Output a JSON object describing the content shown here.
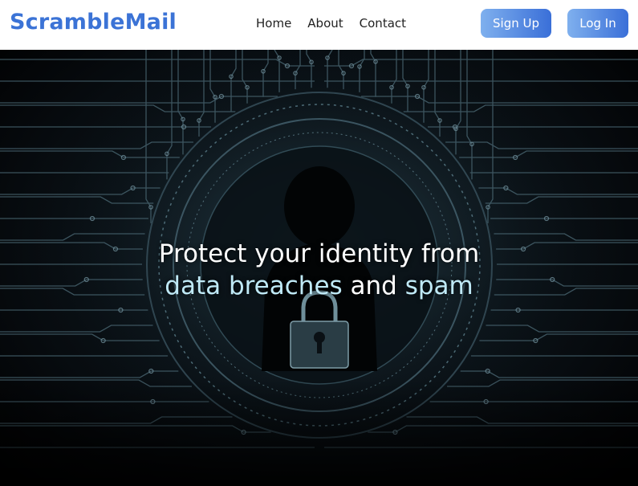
{
  "brand": {
    "name": "ScrambleMail",
    "color": "#3b73d6"
  },
  "nav": {
    "links": [
      {
        "label": "Home"
      },
      {
        "label": "About"
      },
      {
        "label": "Contact"
      }
    ],
    "signup_label": "Sign Up",
    "login_label": "Log In"
  },
  "hero": {
    "line1": "Protect your identity from",
    "line2_part1": "data breaches",
    "line2_part2": " and ",
    "line2_part3": "spam",
    "highlight_color": "#bfe9f6",
    "background_image": "circuit-board-silhouette-padlock"
  }
}
